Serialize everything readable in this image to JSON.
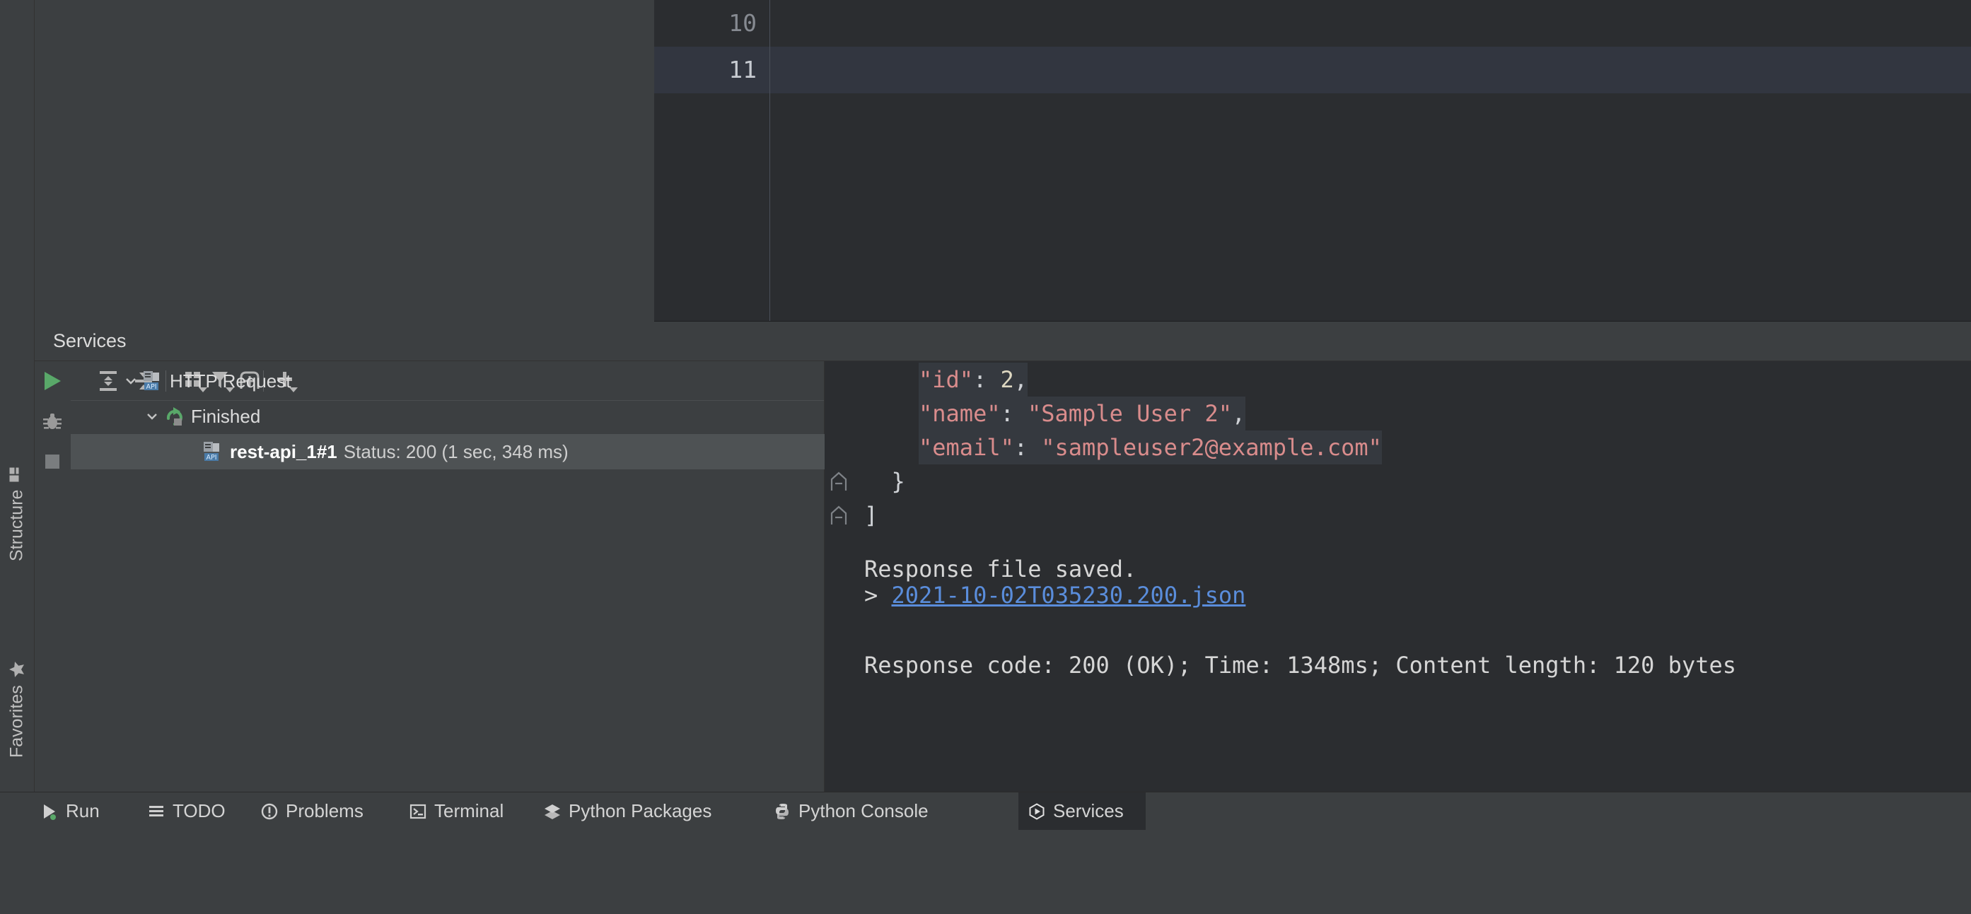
{
  "editor": {
    "lines": [
      {
        "number": "10",
        "text": "",
        "current": false
      },
      {
        "number": "11",
        "text": "",
        "current": true
      }
    ]
  },
  "services": {
    "title": "Services",
    "run_controls": [
      {
        "name": "run-button",
        "icon": "run-icon",
        "label": "Run"
      },
      {
        "name": "debug-button",
        "icon": "debug-icon",
        "label": "Debug"
      },
      {
        "name": "stop-button",
        "icon": "stop-icon",
        "label": "Stop"
      }
    ],
    "toolbar": [
      {
        "name": "expand-all-button",
        "icon": "expand-all-icon",
        "label": "Expand All"
      },
      {
        "name": "collapse-all-button",
        "icon": "collapse-all-icon",
        "label": "Collapse All"
      },
      {
        "name": "group-by-button",
        "icon": "group-by-icon",
        "label": "Group By"
      },
      {
        "name": "filter-button",
        "icon": "filter-icon",
        "label": "Filter"
      },
      {
        "name": "show-in-new-tab-button",
        "icon": "new-tab-icon",
        "label": "Show in New Tab"
      },
      {
        "name": "add-service-button",
        "icon": "plus-icon",
        "label": "Add Service"
      }
    ],
    "tree": [
      {
        "label": "HTTP Request",
        "icon": "http-request-api-icon",
        "expanded": true,
        "selected": false,
        "arrow": "chevron-down-icon",
        "depth": 0,
        "sublabel": ""
      },
      {
        "label": "Finished",
        "icon": "finished-rerun-icon",
        "expanded": true,
        "selected": false,
        "arrow": "chevron-down-icon",
        "depth": 1,
        "sublabel": ""
      },
      {
        "label": "rest-api_1#1",
        "icon": "http-request-api-icon",
        "expanded": false,
        "selected": true,
        "arrow": "",
        "depth": 2,
        "sublabel": "Status: 200 (1 sec, 348 ms)"
      }
    ]
  },
  "console": {
    "json_lines": [
      {
        "indent": 4,
        "parts": [
          {
            "t": "\"id\"",
            "c": "k-str"
          },
          {
            "t": ": ",
            "c": "k-punct"
          },
          {
            "t": "2",
            "c": "k-num"
          },
          {
            "t": ",",
            "c": "k-punct"
          }
        ],
        "selected": true
      },
      {
        "indent": 4,
        "parts": [
          {
            "t": "\"name\"",
            "c": "k-str"
          },
          {
            "t": ": ",
            "c": "k-punct"
          },
          {
            "t": "\"Sample User 2\"",
            "c": "k-str"
          },
          {
            "t": ",",
            "c": "k-punct"
          }
        ],
        "selected": true
      },
      {
        "indent": 4,
        "parts": [
          {
            "t": "\"email\"",
            "c": "k-str"
          },
          {
            "t": ": ",
            "c": "k-punct"
          },
          {
            "t": "\"sampleuser2@example.com\"",
            "c": "k-str"
          }
        ],
        "selected": true
      },
      {
        "indent": 2,
        "parts": [
          {
            "t": "}",
            "c": "k-punct"
          }
        ],
        "selected": false,
        "fold": true
      },
      {
        "indent": 0,
        "parts": [
          {
            "t": "]",
            "c": "k-punct"
          }
        ],
        "selected": false,
        "fold": true
      }
    ],
    "saved_message": "Response file saved.",
    "saved_file_prefix": "> ",
    "saved_file_link": "2021-10-02T035230.200.json",
    "response_summary": "Response code: 200 (OK); Time: 1348ms; Content length: 120 bytes"
  },
  "left_stripe": [
    {
      "label": "Structure",
      "icon": "structure-icon"
    },
    {
      "label": "Favorites",
      "icon": "star-icon"
    }
  ],
  "status_bar": {
    "tabs": [
      {
        "label": "Run",
        "icon": "run-icon",
        "active": false
      },
      {
        "label": "TODO",
        "icon": "todo-icon",
        "active": false
      },
      {
        "label": "Problems",
        "icon": "problems-icon",
        "active": false
      },
      {
        "label": "Terminal",
        "icon": "terminal-icon",
        "active": false
      },
      {
        "label": "Python Packages",
        "icon": "packages-icon",
        "active": false
      },
      {
        "label": "Python Console",
        "icon": "python-icon",
        "active": false
      },
      {
        "label": "Services",
        "icon": "services-icon",
        "active": true
      }
    ]
  },
  "colors": {
    "accent_green": "#59a869",
    "link_blue": "#5a8ddb",
    "string_red": "#d98c8c",
    "number_tan": "#ddd7c1",
    "panel_bg": "#3c3f41",
    "editor_bg": "#2b2d30",
    "selection_bg": "#4e5254"
  }
}
